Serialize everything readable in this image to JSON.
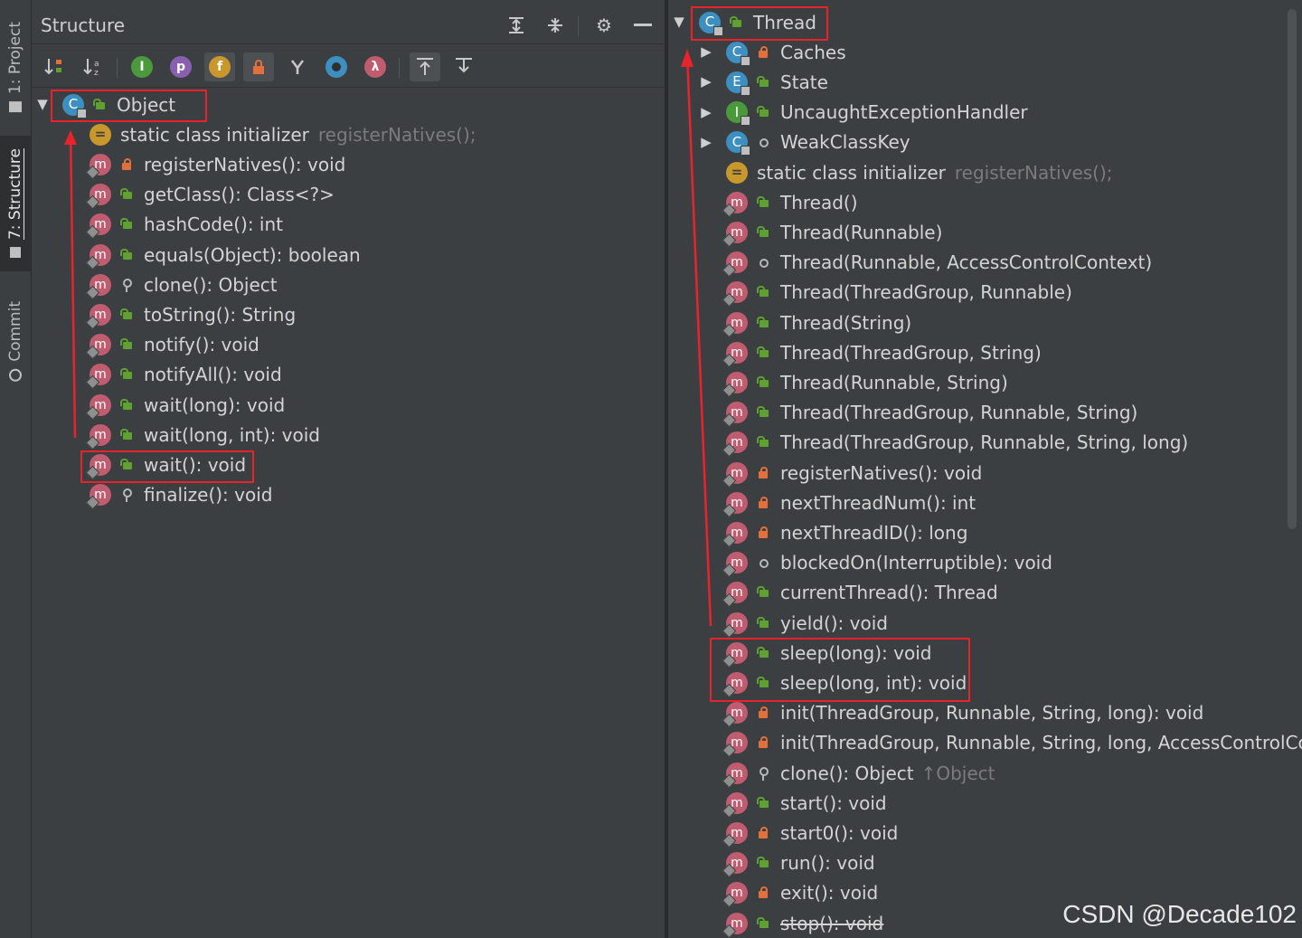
{
  "sidebar": {
    "tabs": [
      {
        "label": "1: Project"
      },
      {
        "label": "7: Structure"
      },
      {
        "label": "Commit"
      }
    ]
  },
  "structure_panel": {
    "title": "Structure",
    "header_icons": [
      "expand-all-icon",
      "collapse-all-icon",
      "gear-icon",
      "minimize-icon"
    ],
    "toolbar_icons": [
      "sort-by-visibility-icon",
      "sort-alphabetically-icon",
      "show-inherited-icon",
      "show-properties-icon",
      "show-fields-icon",
      "show-non-public-icon",
      "show-anonymous-icon",
      "show-lambdas-icon",
      "autoscroll-to-source-icon",
      "autoscroll-from-source-icon"
    ],
    "toolbar_letters": {
      "inherited": "I",
      "properties": "p",
      "fields": "f",
      "lambdas": "λ"
    }
  },
  "left_tree": {
    "root": {
      "label": "Object",
      "kind": "class"
    },
    "items": [
      {
        "kind": "static",
        "label": "static class initializer",
        "hint": "registerNatives();",
        "vis": "none"
      },
      {
        "kind": "method",
        "label": "registerNatives(): void",
        "vis": "private"
      },
      {
        "kind": "method",
        "label": "getClass(): Class<?>",
        "vis": "public"
      },
      {
        "kind": "method",
        "label": "hashCode(): int",
        "vis": "public"
      },
      {
        "kind": "method",
        "label": "equals(Object): boolean",
        "vis": "public"
      },
      {
        "kind": "method",
        "label": "clone(): Object",
        "vis": "protected"
      },
      {
        "kind": "method",
        "label": "toString(): String",
        "vis": "public"
      },
      {
        "kind": "method",
        "label": "notify(): void",
        "vis": "public"
      },
      {
        "kind": "method",
        "label": "notifyAll(): void",
        "vis": "public"
      },
      {
        "kind": "method",
        "label": "wait(long): void",
        "vis": "public"
      },
      {
        "kind": "method",
        "label": "wait(long, int): void",
        "vis": "public"
      },
      {
        "kind": "method",
        "label": "wait(): void",
        "vis": "public"
      },
      {
        "kind": "method",
        "label": "finalize(): void",
        "vis": "protected"
      }
    ]
  },
  "right_tree": {
    "root": {
      "label": "Thread",
      "kind": "class"
    },
    "nested": [
      {
        "kind": "class",
        "icon_letter": "C",
        "label": "Caches",
        "vis": "private"
      },
      {
        "kind": "enum",
        "icon_letter": "E",
        "label": "State",
        "vis": "public"
      },
      {
        "kind": "interface",
        "icon_letter": "I",
        "label": "UncaughtExceptionHandler",
        "vis": "public"
      },
      {
        "kind": "class",
        "icon_letter": "C",
        "label": "WeakClassKey",
        "vis": "package"
      }
    ],
    "static_init": {
      "label": "static class initializer",
      "hint": "registerNatives();"
    },
    "items": [
      {
        "label": "Thread()",
        "vis": "public"
      },
      {
        "label": "Thread(Runnable)",
        "vis": "public"
      },
      {
        "label": "Thread(Runnable, AccessControlContext)",
        "vis": "package"
      },
      {
        "label": "Thread(ThreadGroup, Runnable)",
        "vis": "public"
      },
      {
        "label": "Thread(String)",
        "vis": "public"
      },
      {
        "label": "Thread(ThreadGroup, String)",
        "vis": "public"
      },
      {
        "label": "Thread(Runnable, String)",
        "vis": "public"
      },
      {
        "label": "Thread(ThreadGroup, Runnable, String)",
        "vis": "public"
      },
      {
        "label": "Thread(ThreadGroup, Runnable, String, long)",
        "vis": "public"
      },
      {
        "label": "registerNatives(): void",
        "vis": "private"
      },
      {
        "label": "nextThreadNum(): int",
        "vis": "private"
      },
      {
        "label": "nextThreadID(): long",
        "vis": "private"
      },
      {
        "label": "blockedOn(Interruptible): void",
        "vis": "package"
      },
      {
        "label": "currentThread(): Thread",
        "vis": "public"
      },
      {
        "label": "yield(): void",
        "vis": "public"
      },
      {
        "label": "sleep(long): void",
        "vis": "public"
      },
      {
        "label": "sleep(long, int): void",
        "vis": "public"
      },
      {
        "label": "init(ThreadGroup, Runnable, String, long): void",
        "vis": "private"
      },
      {
        "label": "init(ThreadGroup, Runnable, String, long, AccessControlConte",
        "vis": "private"
      },
      {
        "label": "clone(): Object",
        "vis": "protected",
        "hint": "↑Object"
      },
      {
        "label": "start(): void",
        "vis": "public"
      },
      {
        "label": "start0(): void",
        "vis": "private"
      },
      {
        "label": "run(): void",
        "vis": "public"
      },
      {
        "label": "exit(): void",
        "vis": "private"
      },
      {
        "label": "stop(): void",
        "vis": "public",
        "deprecated": true
      }
    ]
  },
  "watermark": "CSDN @Decade102",
  "colors": {
    "background": "#3c3f41",
    "highlight_box": "#e8232b",
    "method_icon": "#c05c70",
    "class_icon": "#3c8fc0",
    "interface_icon": "#4a9a3c",
    "static_icon": "#c9982c",
    "public_vis": "#5fa033",
    "private_vis": "#e3703a"
  }
}
